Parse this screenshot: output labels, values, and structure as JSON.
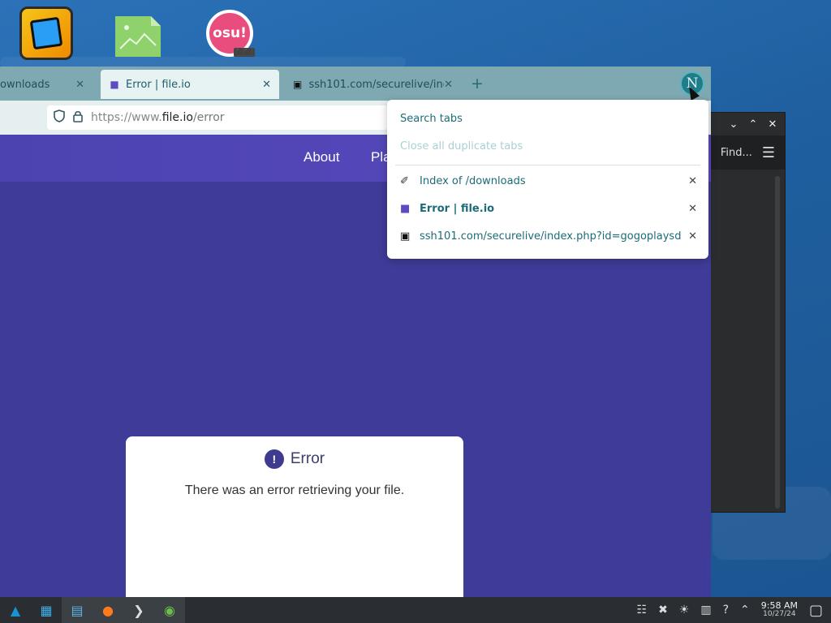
{
  "desktop": {
    "icons": [
      {
        "name": "geometry-dash-icon"
      },
      {
        "name": "image-file-icon"
      },
      {
        "name": "osu-icon",
        "label": "osu!",
        "badge": "⬛⬛"
      }
    ]
  },
  "dark_window": {
    "controls": [
      "⌄",
      "⌃",
      "✕"
    ],
    "find_label": "Find...",
    "menu_icon": "☰"
  },
  "browser": {
    "tabs": [
      {
        "title": "ownloads",
        "icon": "",
        "close": "✕",
        "active": false
      },
      {
        "title": "Error | file.io",
        "icon": "■",
        "close": "✕",
        "active": true
      },
      {
        "title": "ssh101.com/securelive/ind",
        "icon": "▣",
        "close": "✕",
        "active": false
      }
    ],
    "new_tab": "+",
    "account_initial": "N",
    "url": {
      "scheme": "https://www.",
      "host": "file.io",
      "path": "/error"
    },
    "page": {
      "nav": [
        "About",
        "Pla"
      ],
      "error_title": "Error",
      "error_icon": "!",
      "error_message": "There was an error retrieving your file."
    }
  },
  "tab_popup": {
    "search": "Search tabs",
    "close_duplicates": "Close all duplicate tabs",
    "items": [
      {
        "title": "Index of /downloads",
        "icon": "✐",
        "close": "✕",
        "current": false
      },
      {
        "title": "Error | file.io",
        "icon": "■",
        "close": "✕",
        "current": true
      },
      {
        "title": "ssh101.com/securelive/index.php?id=gogoplaysd",
        "icon": "▣",
        "close": "✕",
        "current": false
      }
    ]
  },
  "taskbar": {
    "apps": [
      "▲",
      "▦",
      "▤",
      "●",
      "❯",
      "◉"
    ],
    "tray": [
      "☷",
      "✖",
      "☀",
      "▥",
      "?",
      "⌃"
    ],
    "time": "9:58 AM",
    "date": "10/27/24",
    "show_desktop": "▢"
  },
  "colors": {
    "page_bg": "#3f3b98",
    "tabstrip": "#7fa9b2",
    "accent": "#1b6c78"
  }
}
